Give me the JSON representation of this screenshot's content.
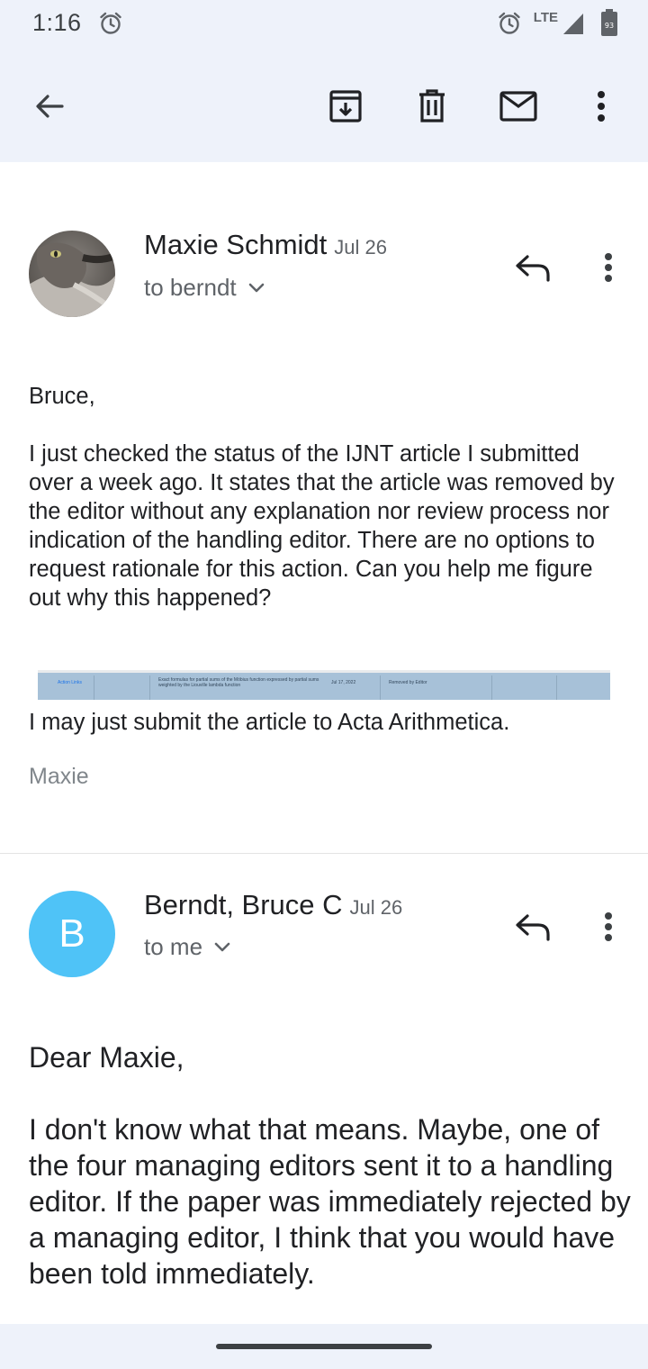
{
  "status": {
    "time": "1:16",
    "network": "LTE",
    "battery": "93",
    "icons": [
      "alarm-icon",
      "signal-icon",
      "battery-icon"
    ]
  },
  "toolbar": {
    "icons": [
      "back-arrow-icon",
      "archive-icon",
      "delete-icon",
      "mark-unread-icon",
      "more-vert-icon"
    ]
  },
  "messages": [
    {
      "sender": "Maxie Schmidt",
      "date": "Jul 26",
      "recipient": "to berndt",
      "greeting": "Bruce,",
      "body": "I just checked the status of the IJNT article I submitted over a week ago. It states that the article was removed by the editor without any explanation nor review process nor indication of the handling editor. There are no options to request rationale for this action. Can you help me figure out why this happened?",
      "attachment": {
        "link": "Action Links",
        "title": "Exact formulas for partial sums of the Möbius function expressed by partial sums weighted by the Liouville lambda function",
        "date": "Jul 17, 2022",
        "status": "Removed by Editor"
      },
      "closing": "I may just submit the article to Acta Arithmetica.",
      "signature": "Maxie"
    },
    {
      "sender": "Berndt, Bruce C",
      "date": "Jul 26",
      "recipient": "to me",
      "avatar_letter": "B",
      "avatar_color": "#4fc3f7",
      "greeting": "Dear Maxie,",
      "body": "I don't know what that means.  Maybe, one of the four managing editors sent it to a handling editor.  If the paper was immediately rejected by a managing editor, I think that you would have been told immediately."
    }
  ]
}
